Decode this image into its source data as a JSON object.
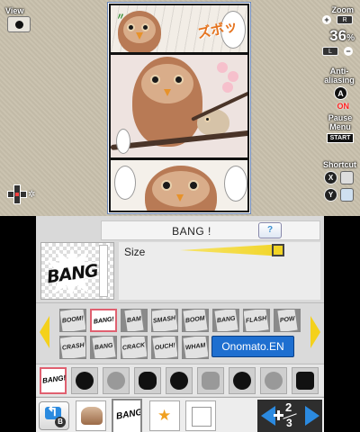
{
  "top_screen": {
    "view_label": "View",
    "zoom": {
      "label": "Zoom",
      "value": "36",
      "unit": "%",
      "zoom_in_key": "R",
      "zoom_out_key": "L"
    },
    "antialiasing": {
      "label": "Anti-aliasing",
      "button": "A",
      "state": "ON"
    },
    "pause": {
      "label": "Pause Menu",
      "button": "START"
    },
    "shortcut": {
      "label": "Shortcut",
      "buttons": [
        "X",
        "Y"
      ]
    },
    "sfx_text": "ズボッ"
  },
  "bottom_screen": {
    "title": "BANG !",
    "help_button": "?",
    "preview_text": "BANG!",
    "size_label": "Size",
    "size_level": 1.0,
    "stamps": {
      "row1": [
        "BOOM!",
        "BANG!",
        "BAM",
        "SMASH",
        "BOOM",
        "BANG",
        "FLASH",
        "POW"
      ],
      "row2": [
        "CRASH",
        "BANG",
        "CRACK",
        "OUCH!",
        "WHAM"
      ],
      "selected": "BANG!",
      "font_button": "Onomato.EN"
    },
    "shapes": [
      "BANG!",
      "",
      "",
      "",
      "",
      "",
      "",
      "",
      ""
    ],
    "toolbar": {
      "back_key": "B",
      "pager": {
        "current": "2",
        "total": "3"
      }
    },
    "colors": {
      "accent_blue": "#1e6fd0",
      "highlight_yellow": "#f4d11c",
      "selection_pink": "#e06070"
    }
  }
}
